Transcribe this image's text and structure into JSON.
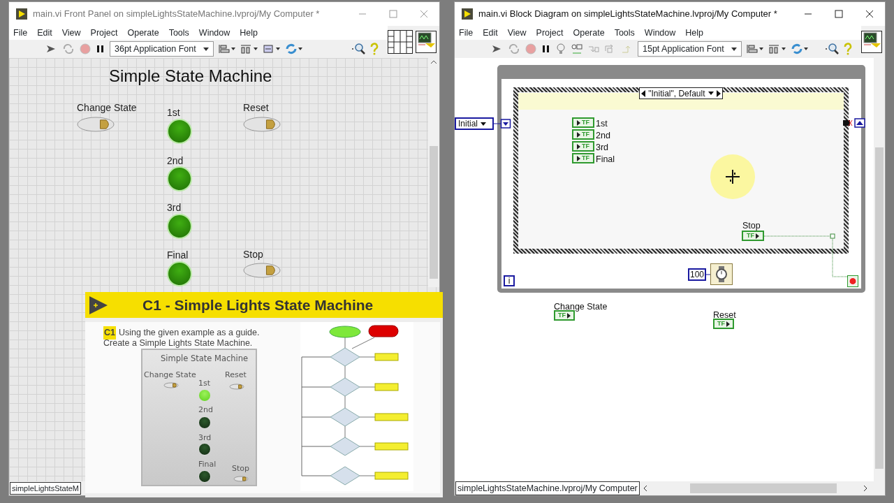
{
  "front_panel": {
    "window": {
      "title": "main.vi Front Panel on simpleLightsStateMachine.lvproj/My Computer *",
      "active": false
    },
    "menu": [
      "File",
      "Edit",
      "View",
      "Project",
      "Operate",
      "Tools",
      "Window",
      "Help"
    ],
    "font_selector": "36pt Application Font",
    "panel_title": "Simple State Machine",
    "controls": [
      {
        "kind": "switch",
        "label": "Change State",
        "on": false
      },
      {
        "kind": "led",
        "label": "1st",
        "on": true
      },
      {
        "kind": "switch",
        "label": "Reset",
        "on": false
      },
      {
        "kind": "led",
        "label": "2nd",
        "on": true
      },
      {
        "kind": "led",
        "label": "3rd",
        "on": true
      },
      {
        "kind": "led",
        "label": "Final",
        "on": true
      },
      {
        "kind": "switch",
        "label": "Stop",
        "on": false
      }
    ],
    "status": "simpleLightsStateM"
  },
  "exercise": {
    "title": "C1 - Simple Lights State Machine",
    "tag": "C1",
    "instructions": [
      "Using the given example as a guide.",
      "Create a Simple Lights State Machine."
    ],
    "example_panel": {
      "title": "Simple State Machine",
      "controls": [
        {
          "kind": "switch",
          "label": "Change State",
          "on": false
        },
        {
          "kind": "led",
          "label": "1st",
          "on": true
        },
        {
          "kind": "switch",
          "label": "Reset",
          "on": false
        },
        {
          "kind": "led",
          "label": "2nd",
          "on": false
        },
        {
          "kind": "led",
          "label": "3rd",
          "on": false
        },
        {
          "kind": "led",
          "label": "Final",
          "on": false
        },
        {
          "kind": "switch",
          "label": "Stop",
          "on": false
        }
      ]
    }
  },
  "block_diagram": {
    "window": {
      "title": "main.vi Block Diagram on simpleLightsStateMachine.lvproj/My Computer *",
      "active": true
    },
    "menu": [
      "File",
      "Edit",
      "View",
      "Project",
      "Operate",
      "Tools",
      "Window",
      "Help"
    ],
    "font_selector": "15pt Application Font",
    "enum_constant": "Initial",
    "case_selector": "\"Initial\", Default",
    "indicators": [
      {
        "label": "1st",
        "data_type": "TF"
      },
      {
        "label": "2nd",
        "data_type": "TF"
      },
      {
        "label": "3rd",
        "data_type": "TF"
      },
      {
        "label": "Final",
        "data_type": "TF"
      }
    ],
    "stop_terminal": {
      "label": "Stop",
      "data_type": "TF"
    },
    "iteration_terminal": "i",
    "wait_constant": "100",
    "loose_terminals": [
      {
        "label": "Change State",
        "data_type": "TF"
      },
      {
        "label": "Reset",
        "data_type": "TF"
      }
    ],
    "status": "simpleLightsStateMachine.lvproj/My Computer"
  }
}
